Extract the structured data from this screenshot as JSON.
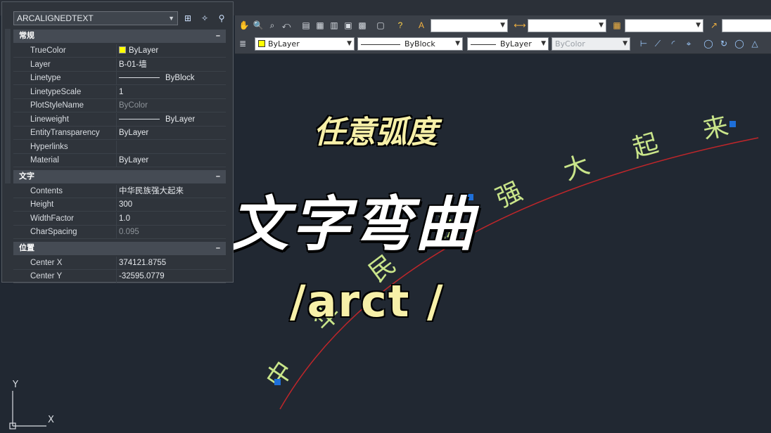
{
  "palette": {
    "object_type": "ARCALIGNEDTEXT",
    "sections": [
      {
        "title": "常规",
        "rows": [
          {
            "name": "TrueColor",
            "value": "ByLayer"
          },
          {
            "name": "Layer",
            "value": "B-01-墙"
          },
          {
            "name": "Linetype",
            "value": "ByBlock"
          },
          {
            "name": "LinetypeScale",
            "value": "1"
          },
          {
            "name": "PlotStyleName",
            "value": "ByColor"
          },
          {
            "name": "Lineweight",
            "value": "ByLayer"
          },
          {
            "name": "EntityTransparency",
            "value": "ByLayer"
          },
          {
            "name": "Hyperlinks",
            "value": ""
          },
          {
            "name": "Material",
            "value": "ByLayer"
          }
        ]
      },
      {
        "title": "文字",
        "rows": [
          {
            "name": "Contents",
            "value": "中华民族强大起来"
          },
          {
            "name": "Height",
            "value": "300"
          },
          {
            "name": "WidthFactor",
            "value": "1.0"
          },
          {
            "name": "CharSpacing",
            "value": "0.095"
          }
        ]
      },
      {
        "title": "位置",
        "rows": [
          {
            "name": "Center X",
            "value": "374121.8755"
          },
          {
            "name": "Center Y",
            "value": "-32595.0779"
          }
        ]
      }
    ],
    "collapse_glyph": "–"
  },
  "toolbar": {
    "color_combo": "ByLayer",
    "linetype_combo": "ByBlock",
    "lineweight_combo": "ByLayer",
    "plotstyle_combo": "ByColor"
  },
  "overlay": {
    "subtitle": "任意弧度",
    "title": "文字弯曲",
    "command": "/arct /"
  },
  "drawing": {
    "arc_chars": [
      "中",
      "华",
      "民",
      "族",
      "强",
      "大",
      "起",
      "来"
    ],
    "arc_color": "#c0262a",
    "text_color": "#c9e58a",
    "grip_color": "#1e6fd9",
    "ucs_x": "X",
    "ucs_y": "Y"
  }
}
